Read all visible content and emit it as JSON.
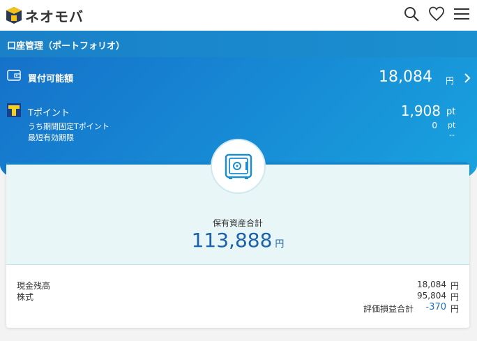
{
  "header": {
    "logo_text": "ネオモバ",
    "icons": [
      "search-icon",
      "heart-icon",
      "menu-icon"
    ]
  },
  "titlebar": {
    "title": "口座管理（ポートフォリオ）"
  },
  "buying_power": {
    "label": "買付可能額",
    "value": "18,084",
    "unit": "円"
  },
  "tpoint": {
    "logo_letter": "T",
    "label": "Tポイント",
    "value": "1,908",
    "unit": "pt",
    "limited_label": "うち期間固定Tポイント",
    "limited_value": "0",
    "limited_unit": "pt",
    "expiry_label": "最短有効期限",
    "expiry_value": "--"
  },
  "assets": {
    "total_label": "保有資産合計",
    "total_value": "113,888",
    "total_unit": "円",
    "cash_label": "現金残高",
    "cash_value": "18,084",
    "cash_unit": "円",
    "stock_label": "株式",
    "stock_value": "95,804",
    "stock_unit": "円",
    "pl_label": "評価損益合計",
    "pl_value": "-370",
    "pl_unit": "円"
  },
  "colors": {
    "brand_blue": "#1583cc",
    "card_tint": "#e8f6f7",
    "value_blue": "#1b60a8",
    "negative_blue": "#1a6fc6"
  }
}
